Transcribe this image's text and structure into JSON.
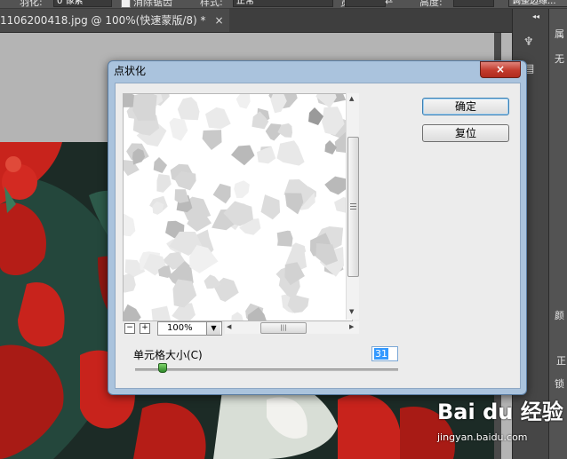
{
  "options_bar": {
    "feather_label": "羽化:",
    "feather_value": "0 像素",
    "antialias_label": "消除锯齿",
    "style_label": "样式:",
    "style_value": "正常",
    "width_label": "宽度:",
    "height_label": "高度:",
    "refine_edge_label": "调整边缘..."
  },
  "document_tab": {
    "title": "1106200418.jpg @ 100%(快速蒙版/8) *",
    "close": "×"
  },
  "right_panel": {
    "collapse": "◂◂",
    "labels": [
      "属",
      "无",
      "颜",
      "正",
      "锁"
    ]
  },
  "dialog": {
    "title": "点状化",
    "close": "×",
    "ok_label": "确定",
    "reset_label": "复位",
    "zoom_out": "−",
    "zoom_in": "+",
    "zoom_value": "100%",
    "cell_size_label": "单元格大小(C)",
    "cell_size_value": "31",
    "cell_size_fraction": 0.1
  },
  "watermark": {
    "text": "Bai du 经验",
    "url": "jingyan.baidu.com"
  },
  "colors": {
    "dialog_frame": "#aac3dd",
    "dialog_body": "#ececec",
    "ps_dark": "#535353",
    "photo_red": "#c8231c",
    "photo_green": "#1f4a3c"
  }
}
